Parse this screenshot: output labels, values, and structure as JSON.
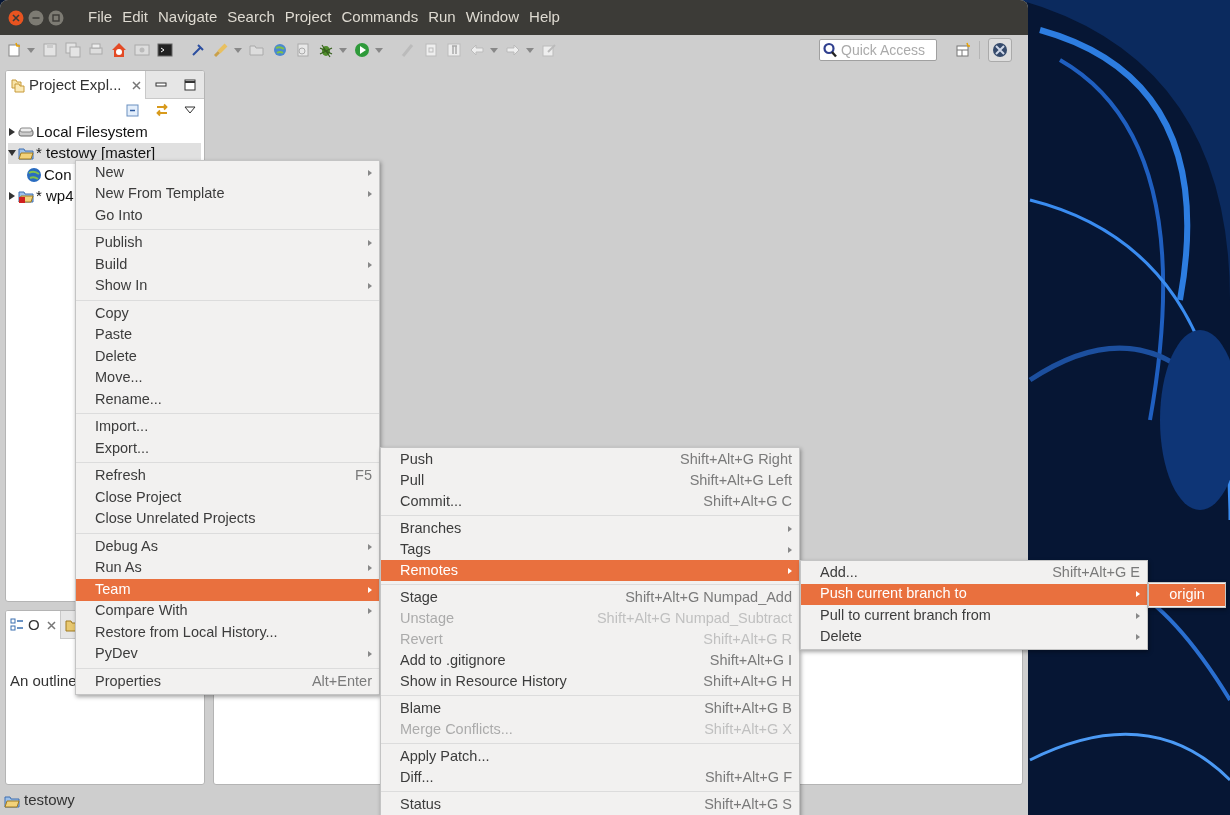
{
  "window": {
    "menu_bar": [
      "File",
      "Edit",
      "Navigate",
      "Search",
      "Project",
      "Commands",
      "Run",
      "Window",
      "Help"
    ]
  },
  "toolbar": {
    "quick_access": {
      "placeholder": "Quick Access"
    }
  },
  "project_explorer": {
    "tab": "Project Expl...",
    "tree": [
      {
        "label": "Local Filesystem",
        "kind": "drive",
        "expanded": false,
        "selected": false
      },
      {
        "label": "* testowy [master]",
        "kind": "project",
        "expanded": true,
        "selected": true,
        "children": [
          {
            "label": "Con",
            "kind": "web",
            "selected": false
          }
        ]
      },
      {
        "label": "* wp4",
        "kind": "project-error",
        "expanded": false,
        "selected": false
      }
    ]
  },
  "outline": {
    "tab": "O",
    "message": "An outline"
  },
  "menus": [
    {
      "sections": [
        [
          {
            "label": "New",
            "submenu": true,
            "selected": false,
            "disabled": false
          },
          {
            "label": "New From Template",
            "submenu": true,
            "selected": false,
            "disabled": false
          },
          {
            "label": "Go Into",
            "submenu": false,
            "selected": false,
            "disabled": false
          }
        ],
        [
          {
            "label": "Publish",
            "submenu": true,
            "selected": false,
            "disabled": false
          },
          {
            "label": "Build",
            "submenu": true,
            "selected": false,
            "disabled": false
          },
          {
            "label": "Show In",
            "submenu": true,
            "selected": false,
            "disabled": false
          }
        ],
        [
          {
            "label": "Copy",
            "submenu": false,
            "selected": false,
            "disabled": false
          },
          {
            "label": "Paste",
            "submenu": false,
            "selected": false,
            "disabled": false
          },
          {
            "label": "Delete",
            "submenu": false,
            "selected": false,
            "disabled": false
          },
          {
            "label": "Move...",
            "submenu": false,
            "selected": false,
            "disabled": false
          },
          {
            "label": "Rename...",
            "submenu": false,
            "selected": false,
            "disabled": false
          }
        ],
        [
          {
            "label": "Import...",
            "submenu": false,
            "selected": false,
            "disabled": false
          },
          {
            "label": "Export...",
            "submenu": false,
            "selected": false,
            "disabled": false
          }
        ],
        [
          {
            "label": "Refresh",
            "shortcut": "F5",
            "submenu": false,
            "selected": false,
            "disabled": false
          },
          {
            "label": "Close Project",
            "submenu": false,
            "selected": false,
            "disabled": false
          },
          {
            "label": "Close Unrelated Projects",
            "submenu": false,
            "selected": false,
            "disabled": false
          }
        ],
        [
          {
            "label": "Debug As",
            "submenu": true,
            "selected": false,
            "disabled": false
          },
          {
            "label": "Run As",
            "submenu": true,
            "selected": false,
            "disabled": false
          },
          {
            "label": "Team",
            "submenu": true,
            "selected": true,
            "disabled": false
          },
          {
            "label": "Compare With",
            "submenu": true,
            "selected": false,
            "disabled": false
          },
          {
            "label": "Restore from Local History...",
            "submenu": false,
            "selected": false,
            "disabled": false
          },
          {
            "label": "PyDev",
            "submenu": true,
            "selected": false,
            "disabled": false
          }
        ],
        [
          {
            "label": "Properties",
            "shortcut": "Alt+Enter",
            "submenu": false,
            "selected": false,
            "disabled": false
          }
        ]
      ]
    },
    {
      "sections": [
        [
          {
            "label": "Push",
            "shortcut": "Shift+Alt+G Right",
            "submenu": false,
            "selected": false,
            "disabled": false
          },
          {
            "label": "Pull",
            "shortcut": "Shift+Alt+G Left",
            "submenu": false,
            "selected": false,
            "disabled": false
          },
          {
            "label": "Commit...",
            "shortcut": "Shift+Alt+G C",
            "submenu": false,
            "selected": false,
            "disabled": false
          }
        ],
        [
          {
            "label": "Branches",
            "submenu": true,
            "selected": false,
            "disabled": false
          },
          {
            "label": "Tags",
            "submenu": true,
            "selected": false,
            "disabled": false
          },
          {
            "label": "Remotes",
            "submenu": true,
            "selected": true,
            "disabled": false
          }
        ],
        [
          {
            "label": "Stage",
            "shortcut": "Shift+Alt+G Numpad_Add",
            "submenu": false,
            "selected": false,
            "disabled": false
          },
          {
            "label": "Unstage",
            "shortcut": "Shift+Alt+G Numpad_Subtract",
            "submenu": false,
            "selected": false,
            "disabled": true
          },
          {
            "label": "Revert",
            "shortcut": "Shift+Alt+G R",
            "submenu": false,
            "selected": false,
            "disabled": true
          },
          {
            "label": "Add to .gitignore",
            "shortcut": "Shift+Alt+G I",
            "submenu": false,
            "selected": false,
            "disabled": false
          },
          {
            "label": "Show in Resource History",
            "shortcut": "Shift+Alt+G H",
            "submenu": false,
            "selected": false,
            "disabled": false
          }
        ],
        [
          {
            "label": "Blame",
            "shortcut": "Shift+Alt+G B",
            "submenu": false,
            "selected": false,
            "disabled": false
          },
          {
            "label": "Merge Conflicts...",
            "shortcut": "Shift+Alt+G X",
            "submenu": false,
            "selected": false,
            "disabled": true
          }
        ],
        [
          {
            "label": "Apply Patch...",
            "submenu": false,
            "selected": false,
            "disabled": false
          },
          {
            "label": "Diff...",
            "shortcut": "Shift+Alt+G F",
            "submenu": false,
            "selected": false,
            "disabled": false
          }
        ],
        [
          {
            "label": "Status",
            "shortcut": "Shift+Alt+G S",
            "submenu": false,
            "selected": false,
            "disabled": false
          }
        ]
      ]
    },
    {
      "sections": [
        [
          {
            "label": "Add...",
            "shortcut": "Shift+Alt+G E",
            "submenu": false,
            "selected": false,
            "disabled": false
          },
          {
            "label": "Push current branch to",
            "submenu": true,
            "selected": true,
            "disabled": false
          },
          {
            "label": "Pull to current branch from",
            "submenu": true,
            "selected": false,
            "disabled": false
          },
          {
            "label": "Delete",
            "submenu": true,
            "selected": false,
            "disabled": false
          }
        ]
      ]
    },
    {
      "sections": [
        [
          {
            "label": "origin",
            "submenu": false,
            "selected": true,
            "disabled": false
          }
        ]
      ]
    }
  ],
  "status_bar": {
    "text": "testowy"
  }
}
